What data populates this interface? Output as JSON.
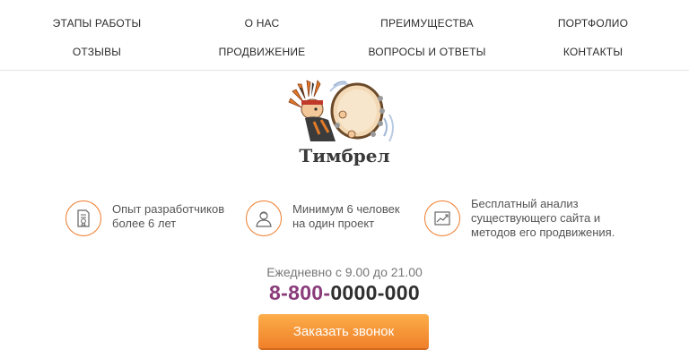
{
  "nav": {
    "row1": [
      "ЭТАПЫ РАБОТЫ",
      "О НАС",
      "ПРЕИМУЩЕСТВА",
      "ПОРТФОЛИО"
    ],
    "row2": [
      "ОТЗЫВЫ",
      "ПРОДВИЖЕНИЕ",
      "ВОПРОСЫ И ОТВЕТЫ",
      "КОНТАКТЫ"
    ]
  },
  "logo": {
    "text": "Тимбрел",
    "icon": "drummer-mascot-icon"
  },
  "features": [
    {
      "icon": "certificate-icon",
      "line1": "Опыт разработчиков",
      "line2": "более 6 лет",
      "line3": ""
    },
    {
      "icon": "user-icon",
      "line1": "Минимум 6 человек",
      "line2": "на один проект",
      "line3": ""
    },
    {
      "icon": "growth-chart-icon",
      "line1": "Бесплатный анализ",
      "line2": "существующего сайта и",
      "line3": "методов его продвижения."
    }
  ],
  "contact": {
    "hours": "Ежедневно с 9.00 до 21.00",
    "phone_prefix": "8-800-",
    "phone_rest": "0000-000",
    "cta_label": "Заказать звонок"
  },
  "colors": {
    "accent": "#f07c2c",
    "phone_prefix": "#8a3b7a",
    "button": "#f39233"
  }
}
